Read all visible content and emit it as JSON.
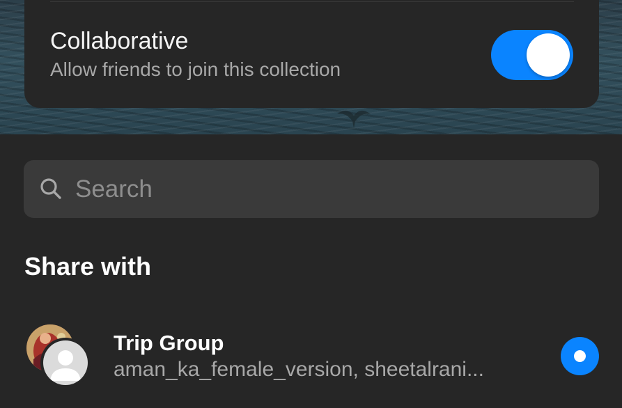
{
  "collaborative": {
    "title": "Collaborative",
    "subtitle": "Allow friends to join this collection",
    "enabled": true,
    "accent_color": "#0a84ff"
  },
  "search": {
    "placeholder": "Search",
    "value": "",
    "icon": "search-icon"
  },
  "share": {
    "heading": "Share with",
    "items": [
      {
        "name": "Trip Group",
        "members": "aman_ka_female_version, sheetalrani...",
        "selected": true,
        "icon": "group-avatar"
      }
    ]
  },
  "colors": {
    "background": "#262626",
    "search_field": "#3a3a3a",
    "secondary_text": "#a8a8a8",
    "accent": "#0a84ff"
  }
}
